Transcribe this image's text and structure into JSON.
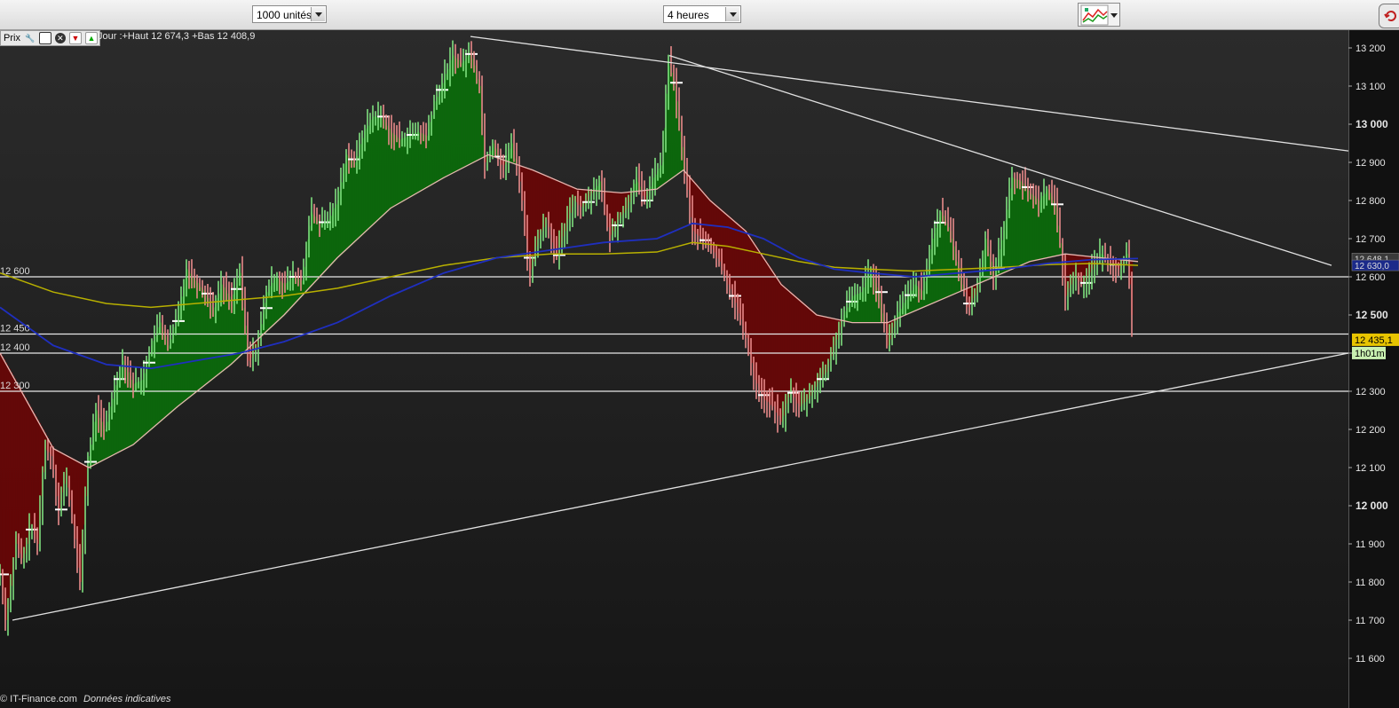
{
  "toolbar": {
    "units_select": "1000 unités",
    "period_select": "4 heures"
  },
  "legend": {
    "label": "Prix",
    "header": "Jour :+Haut 12 674,3 +Bas 12 408,9"
  },
  "footer": {
    "source": "© IT-Finance.com",
    "note": "Données indicatives"
  },
  "colors": {
    "bull_fill": "#0a6d0a",
    "bear_fill": "#6a0606",
    "candle_up": "#7fe07f",
    "candle_down": "#e88a8a",
    "ma_blue": "#1f2fbf",
    "ma_yellow": "#b8b000",
    "ma_pink": "#e7b6b0",
    "price_badge": "#e8c400",
    "timer_badge": "#c8f0b0"
  },
  "chart_data": {
    "type": "candlestick",
    "ylim": [
      11560,
      13240
    ],
    "y_ticks": [
      {
        "value": 13200,
        "label": "13 200",
        "bold": false
      },
      {
        "value": 13100,
        "label": "13 100",
        "bold": false
      },
      {
        "value": 13000,
        "label": "13 000",
        "bold": true
      },
      {
        "value": 12900,
        "label": "12 900",
        "bold": false
      },
      {
        "value": 12800,
        "label": "12 800",
        "bold": false
      },
      {
        "value": 12700,
        "label": "12 700",
        "bold": false
      },
      {
        "value": 12600,
        "label": "12 600",
        "bold": false
      },
      {
        "value": 12500,
        "label": "12 500",
        "bold": true
      },
      {
        "value": 12400,
        "label": "12 400",
        "bold": false
      },
      {
        "value": 12300,
        "label": "12 300",
        "bold": false
      },
      {
        "value": 12200,
        "label": "12 200",
        "bold": false
      },
      {
        "value": 12100,
        "label": "12 100",
        "bold": false
      },
      {
        "value": 12000,
        "label": "12 000",
        "bold": true
      },
      {
        "value": 11900,
        "label": "11 900",
        "bold": false
      },
      {
        "value": 11800,
        "label": "11 800",
        "bold": false
      },
      {
        "value": 11700,
        "label": "11 700",
        "bold": false
      },
      {
        "value": 11600,
        "label": "11 600",
        "bold": false
      }
    ],
    "horizontal_levels": [
      {
        "value": 12600,
        "label": "12 600"
      },
      {
        "value": 12450,
        "label": "12 450"
      },
      {
        "value": 12400,
        "label": "12 400"
      },
      {
        "value": 12300,
        "label": "12 300"
      }
    ],
    "last_price": {
      "value": 12435.1,
      "label": "12 435,1"
    },
    "timer": "1h01m",
    "ma_badges": [
      {
        "value": 12648,
        "label": "12 648,1"
      },
      {
        "value": 12630,
        "label": "12 630,0"
      }
    ],
    "price_path": [
      [
        0,
        11820
      ],
      [
        6,
        11700
      ],
      [
        12,
        11790
      ],
      [
        18,
        11900
      ],
      [
        26,
        11850
      ],
      [
        34,
        11950
      ],
      [
        42,
        11900
      ],
      [
        50,
        12150
      ],
      [
        58,
        12130
      ],
      [
        66,
        11990
      ],
      [
        74,
        12080
      ],
      [
        82,
        11950
      ],
      [
        90,
        11800
      ],
      [
        98,
        12100
      ],
      [
        108,
        12250
      ],
      [
        118,
        12200
      ],
      [
        128,
        12300
      ],
      [
        138,
        12380
      ],
      [
        150,
        12320
      ],
      [
        160,
        12330
      ],
      [
        170,
        12420
      ],
      [
        180,
        12480
      ],
      [
        190,
        12420
      ],
      [
        200,
        12500
      ],
      [
        210,
        12620
      ],
      [
        220,
        12590
      ],
      [
        230,
        12560
      ],
      [
        240,
        12520
      ],
      [
        250,
        12580
      ],
      [
        260,
        12540
      ],
      [
        270,
        12610
      ],
      [
        280,
        12380
      ],
      [
        290,
        12420
      ],
      [
        300,
        12560
      ],
      [
        310,
        12600
      ],
      [
        320,
        12580
      ],
      [
        330,
        12600
      ],
      [
        340,
        12590
      ],
      [
        350,
        12770
      ],
      [
        360,
        12740
      ],
      [
        370,
        12750
      ],
      [
        380,
        12800
      ],
      [
        390,
        12920
      ],
      [
        400,
        12900
      ],
      [
        410,
        12980
      ],
      [
        420,
        13020
      ],
      [
        430,
        13020
      ],
      [
        440,
        12980
      ],
      [
        450,
        12960
      ],
      [
        460,
        12970
      ],
      [
        470,
        12980
      ],
      [
        480,
        12970
      ],
      [
        490,
        13060
      ],
      [
        500,
        13120
      ],
      [
        510,
        13180
      ],
      [
        520,
        13160
      ],
      [
        530,
        13190
      ],
      [
        540,
        13100
      ],
      [
        546,
        12900
      ],
      [
        556,
        12950
      ],
      [
        566,
        12880
      ],
      [
        576,
        12950
      ],
      [
        586,
        12850
      ],
      [
        596,
        12600
      ],
      [
        606,
        12700
      ],
      [
        616,
        12750
      ],
      [
        626,
        12650
      ],
      [
        636,
        12720
      ],
      [
        646,
        12800
      ],
      [
        656,
        12780
      ],
      [
        666,
        12820
      ],
      [
        676,
        12850
      ],
      [
        686,
        12700
      ],
      [
        696,
        12750
      ],
      [
        706,
        12780
      ],
      [
        716,
        12860
      ],
      [
        726,
        12800
      ],
      [
        736,
        12860
      ],
      [
        746,
        12900
      ],
      [
        752,
        13170
      ],
      [
        760,
        13100
      ],
      [
        770,
        12900
      ],
      [
        780,
        12720
      ],
      [
        790,
        12700
      ],
      [
        800,
        12680
      ],
      [
        810,
        12640
      ],
      [
        820,
        12580
      ],
      [
        830,
        12520
      ],
      [
        840,
        12440
      ],
      [
        850,
        12330
      ],
      [
        860,
        12280
      ],
      [
        870,
        12260
      ],
      [
        880,
        12220
      ],
      [
        890,
        12300
      ],
      [
        900,
        12260
      ],
      [
        910,
        12280
      ],
      [
        920,
        12320
      ],
      [
        930,
        12350
      ],
      [
        940,
        12420
      ],
      [
        950,
        12500
      ],
      [
        960,
        12550
      ],
      [
        970,
        12560
      ],
      [
        980,
        12620
      ],
      [
        990,
        12560
      ],
      [
        1000,
        12420
      ],
      [
        1010,
        12500
      ],
      [
        1020,
        12540
      ],
      [
        1030,
        12580
      ],
      [
        1040,
        12560
      ],
      [
        1050,
        12700
      ],
      [
        1060,
        12770
      ],
      [
        1070,
        12720
      ],
      [
        1080,
        12620
      ],
      [
        1090,
        12520
      ],
      [
        1100,
        12560
      ],
      [
        1110,
        12700
      ],
      [
        1120,
        12600
      ],
      [
        1130,
        12720
      ],
      [
        1140,
        12860
      ],
      [
        1150,
        12850
      ],
      [
        1160,
        12820
      ],
      [
        1170,
        12800
      ],
      [
        1180,
        12830
      ],
      [
        1190,
        12780
      ],
      [
        1200,
        12550
      ],
      [
        1210,
        12600
      ],
      [
        1220,
        12580
      ],
      [
        1230,
        12620
      ],
      [
        1240,
        12660
      ],
      [
        1250,
        12640
      ],
      [
        1260,
        12620
      ],
      [
        1270,
        12660
      ],
      [
        1276,
        12420
      ]
    ],
    "ma_blue": [
      [
        0,
        12520
      ],
      [
        60,
        12420
      ],
      [
        120,
        12370
      ],
      [
        170,
        12360
      ],
      [
        220,
        12380
      ],
      [
        270,
        12400
      ],
      [
        320,
        12430
      ],
      [
        380,
        12480
      ],
      [
        440,
        12550
      ],
      [
        500,
        12610
      ],
      [
        560,
        12650
      ],
      [
        620,
        12670
      ],
      [
        680,
        12690
      ],
      [
        740,
        12700
      ],
      [
        780,
        12740
      ],
      [
        820,
        12730
      ],
      [
        860,
        12700
      ],
      [
        900,
        12650
      ],
      [
        940,
        12620
      ],
      [
        980,
        12610
      ],
      [
        1030,
        12600
      ],
      [
        1080,
        12610
      ],
      [
        1130,
        12620
      ],
      [
        1180,
        12635
      ],
      [
        1230,
        12645
      ],
      [
        1282,
        12648
      ]
    ],
    "ma_yellow": [
      [
        0,
        12610
      ],
      [
        60,
        12560
      ],
      [
        120,
        12530
      ],
      [
        170,
        12520
      ],
      [
        220,
        12530
      ],
      [
        270,
        12540
      ],
      [
        320,
        12550
      ],
      [
        380,
        12570
      ],
      [
        440,
        12600
      ],
      [
        500,
        12630
      ],
      [
        560,
        12650
      ],
      [
        620,
        12660
      ],
      [
        680,
        12660
      ],
      [
        740,
        12665
      ],
      [
        780,
        12690
      ],
      [
        820,
        12680
      ],
      [
        860,
        12660
      ],
      [
        900,
        12640
      ],
      [
        940,
        12625
      ],
      [
        980,
        12620
      ],
      [
        1030,
        12615
      ],
      [
        1080,
        12620
      ],
      [
        1130,
        12625
      ],
      [
        1180,
        12632
      ],
      [
        1230,
        12635
      ],
      [
        1282,
        12630
      ]
    ],
    "ma_pink": [
      [
        0,
        12400
      ],
      [
        60,
        12150
      ],
      [
        100,
        12100
      ],
      [
        150,
        12160
      ],
      [
        200,
        12260
      ],
      [
        260,
        12370
      ],
      [
        320,
        12500
      ],
      [
        380,
        12650
      ],
      [
        440,
        12780
      ],
      [
        500,
        12860
      ],
      [
        550,
        12920
      ],
      [
        600,
        12880
      ],
      [
        650,
        12830
      ],
      [
        700,
        12820
      ],
      [
        740,
        12830
      ],
      [
        770,
        12880
      ],
      [
        800,
        12800
      ],
      [
        840,
        12720
      ],
      [
        880,
        12580
      ],
      [
        920,
        12500
      ],
      [
        960,
        12480
      ],
      [
        1000,
        12480
      ],
      [
        1040,
        12520
      ],
      [
        1080,
        12560
      ],
      [
        1120,
        12600
      ],
      [
        1160,
        12640
      ],
      [
        1200,
        12660
      ],
      [
        1240,
        12650
      ],
      [
        1282,
        12640
      ]
    ],
    "trend_lines": [
      {
        "x1": 530,
        "y1": 13230,
        "x2": 1519,
        "y2": 12930
      },
      {
        "x1": 754,
        "y1": 13180,
        "x2": 1500,
        "y2": 12630
      },
      {
        "x1": 14,
        "y1": 11700,
        "x2": 1519,
        "y2": 12400
      }
    ]
  }
}
